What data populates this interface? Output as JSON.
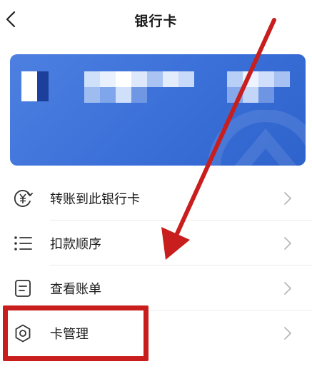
{
  "header": {
    "title": "银行卡",
    "back_icon": "chevron-left-icon"
  },
  "card": {
    "background": "#3a6fd8"
  },
  "menu": [
    {
      "label": "转账到此银行卡",
      "icon": "yuan-transfer-icon"
    },
    {
      "label": "扣款顺序",
      "icon": "list-order-icon"
    },
    {
      "label": "查看账单",
      "icon": "bill-icon"
    },
    {
      "label": "卡管理",
      "icon": "gear-icon"
    }
  ],
  "colors": {
    "annotation": "#c81e1e",
    "chevron": "#b8b8b8",
    "icon": "#333333"
  }
}
